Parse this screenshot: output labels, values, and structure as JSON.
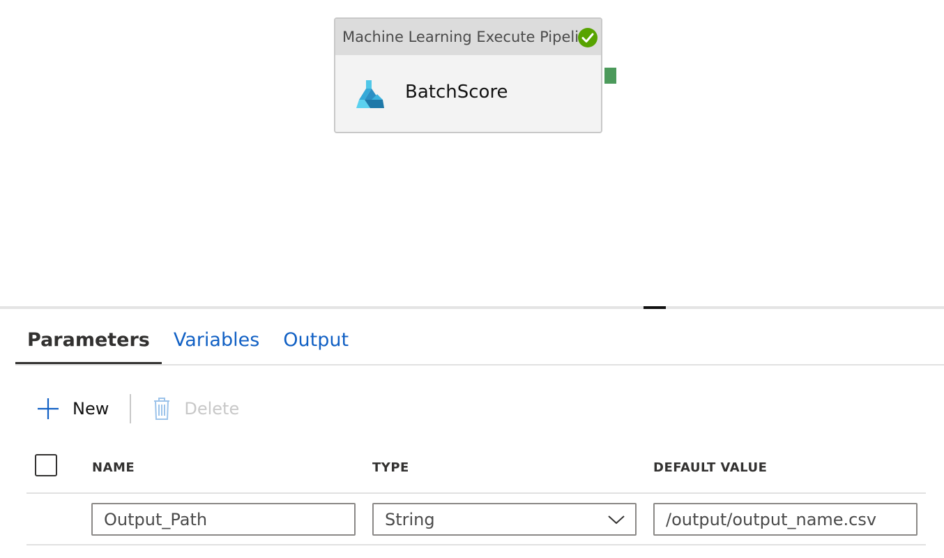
{
  "canvas": {
    "activity": {
      "type_label": "Machine Learning Execute Pipeline",
      "name": "BatchScore",
      "status_icon": "success-check-icon",
      "icon": "ml-flask-icon"
    }
  },
  "bottom_panel": {
    "tabs": [
      {
        "label": "Parameters",
        "active": true
      },
      {
        "label": "Variables",
        "active": false
      },
      {
        "label": "Output",
        "active": false
      }
    ],
    "toolbar": {
      "new_label": "New",
      "delete_label": "Delete"
    },
    "table": {
      "headers": [
        "NAME",
        "TYPE",
        "DEFAULT VALUE"
      ],
      "rows": [
        {
          "name": "Output_Path",
          "type": "String",
          "default_value": "/output/output_name.csv"
        }
      ]
    }
  },
  "colors": {
    "accent": "#1160c4",
    "success": "#57a300",
    "port": "#4c9a5b"
  }
}
